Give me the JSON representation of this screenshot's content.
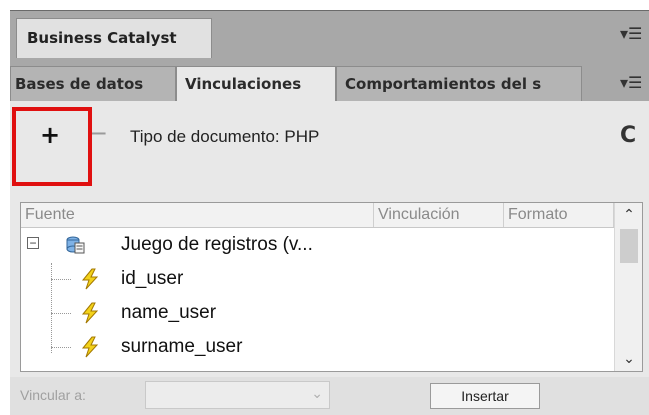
{
  "panel": {
    "title": "Business Catalyst"
  },
  "tabs": [
    {
      "label": "Bases de datos"
    },
    {
      "label": "Vinculaciones"
    },
    {
      "label": "Comportamientos del s"
    }
  ],
  "toolbar": {
    "add_symbol": "+",
    "remove_symbol": "−",
    "document_type": "Tipo de documento: PHP"
  },
  "table": {
    "columns": [
      "Fuente",
      "Vinculación",
      "Formato"
    ],
    "recordset": "Juego de registros (v...",
    "fields": [
      "id_user",
      "name_user",
      "surname_user"
    ]
  },
  "footer": {
    "bind_label": "Vincular a:",
    "insert_label": "Insertar"
  },
  "colors": {
    "highlight": "#e01010",
    "panel_bg": "#e8e8e8",
    "tab_bar": "#a8a8a8"
  },
  "icons": [
    "panel-menu-icon",
    "plus-icon",
    "minus-icon",
    "refresh-icon",
    "expander-icon",
    "database-recordset-icon",
    "bolt-field-icon",
    "scroll-up-icon",
    "scroll-down-icon",
    "dropdown-arrow-icon"
  ]
}
